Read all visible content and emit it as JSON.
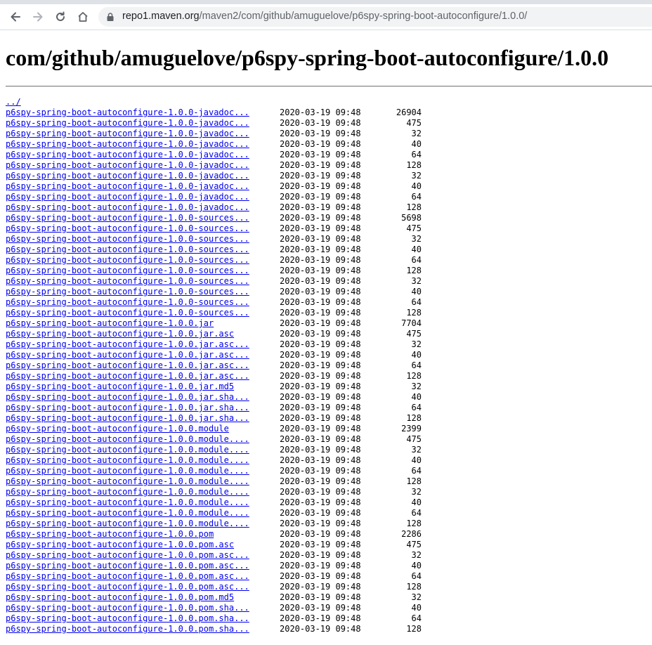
{
  "browser": {
    "url_host": "repo1.maven.org",
    "url_path": "/maven2/com/github/amuguelove/p6spy-spring-boot-autoconfigure/1.0.0/",
    "back_icon": "arrow-left-icon",
    "forward_icon": "arrow-right-icon",
    "reload_icon": "reload-icon",
    "home_icon": "home-icon",
    "lock_icon": "lock-icon"
  },
  "page": {
    "title": "com/github/amuguelove/p6spy-spring-boot-autoconfigure/1.0.0",
    "parent_link": "../"
  },
  "files": [
    {
      "name": "p6spy-spring-boot-autoconfigure-1.0.0-javadoc...",
      "date": "2020-03-19 09:48",
      "size": "26904"
    },
    {
      "name": "p6spy-spring-boot-autoconfigure-1.0.0-javadoc...",
      "date": "2020-03-19 09:48",
      "size": "475"
    },
    {
      "name": "p6spy-spring-boot-autoconfigure-1.0.0-javadoc...",
      "date": "2020-03-19 09:48",
      "size": "32"
    },
    {
      "name": "p6spy-spring-boot-autoconfigure-1.0.0-javadoc...",
      "date": "2020-03-19 09:48",
      "size": "40"
    },
    {
      "name": "p6spy-spring-boot-autoconfigure-1.0.0-javadoc...",
      "date": "2020-03-19 09:48",
      "size": "64"
    },
    {
      "name": "p6spy-spring-boot-autoconfigure-1.0.0-javadoc...",
      "date": "2020-03-19 09:48",
      "size": "128"
    },
    {
      "name": "p6spy-spring-boot-autoconfigure-1.0.0-javadoc...",
      "date": "2020-03-19 09:48",
      "size": "32"
    },
    {
      "name": "p6spy-spring-boot-autoconfigure-1.0.0-javadoc...",
      "date": "2020-03-19 09:48",
      "size": "40"
    },
    {
      "name": "p6spy-spring-boot-autoconfigure-1.0.0-javadoc...",
      "date": "2020-03-19 09:48",
      "size": "64"
    },
    {
      "name": "p6spy-spring-boot-autoconfigure-1.0.0-javadoc...",
      "date": "2020-03-19 09:48",
      "size": "128"
    },
    {
      "name": "p6spy-spring-boot-autoconfigure-1.0.0-sources...",
      "date": "2020-03-19 09:48",
      "size": "5698"
    },
    {
      "name": "p6spy-spring-boot-autoconfigure-1.0.0-sources...",
      "date": "2020-03-19 09:48",
      "size": "475"
    },
    {
      "name": "p6spy-spring-boot-autoconfigure-1.0.0-sources...",
      "date": "2020-03-19 09:48",
      "size": "32"
    },
    {
      "name": "p6spy-spring-boot-autoconfigure-1.0.0-sources...",
      "date": "2020-03-19 09:48",
      "size": "40"
    },
    {
      "name": "p6spy-spring-boot-autoconfigure-1.0.0-sources...",
      "date": "2020-03-19 09:48",
      "size": "64"
    },
    {
      "name": "p6spy-spring-boot-autoconfigure-1.0.0-sources...",
      "date": "2020-03-19 09:48",
      "size": "128"
    },
    {
      "name": "p6spy-spring-boot-autoconfigure-1.0.0-sources...",
      "date": "2020-03-19 09:48",
      "size": "32"
    },
    {
      "name": "p6spy-spring-boot-autoconfigure-1.0.0-sources...",
      "date": "2020-03-19 09:48",
      "size": "40"
    },
    {
      "name": "p6spy-spring-boot-autoconfigure-1.0.0-sources...",
      "date": "2020-03-19 09:48",
      "size": "64"
    },
    {
      "name": "p6spy-spring-boot-autoconfigure-1.0.0-sources...",
      "date": "2020-03-19 09:48",
      "size": "128"
    },
    {
      "name": "p6spy-spring-boot-autoconfigure-1.0.0.jar",
      "date": "2020-03-19 09:48",
      "size": "7704"
    },
    {
      "name": "p6spy-spring-boot-autoconfigure-1.0.0.jar.asc",
      "date": "2020-03-19 09:48",
      "size": "475"
    },
    {
      "name": "p6spy-spring-boot-autoconfigure-1.0.0.jar.asc...",
      "date": "2020-03-19 09:48",
      "size": "32"
    },
    {
      "name": "p6spy-spring-boot-autoconfigure-1.0.0.jar.asc...",
      "date": "2020-03-19 09:48",
      "size": "40"
    },
    {
      "name": "p6spy-spring-boot-autoconfigure-1.0.0.jar.asc...",
      "date": "2020-03-19 09:48",
      "size": "64"
    },
    {
      "name": "p6spy-spring-boot-autoconfigure-1.0.0.jar.asc...",
      "date": "2020-03-19 09:48",
      "size": "128"
    },
    {
      "name": "p6spy-spring-boot-autoconfigure-1.0.0.jar.md5",
      "date": "2020-03-19 09:48",
      "size": "32"
    },
    {
      "name": "p6spy-spring-boot-autoconfigure-1.0.0.jar.sha...",
      "date": "2020-03-19 09:48",
      "size": "40"
    },
    {
      "name": "p6spy-spring-boot-autoconfigure-1.0.0.jar.sha...",
      "date": "2020-03-19 09:48",
      "size": "64"
    },
    {
      "name": "p6spy-spring-boot-autoconfigure-1.0.0.jar.sha...",
      "date": "2020-03-19 09:48",
      "size": "128"
    },
    {
      "name": "p6spy-spring-boot-autoconfigure-1.0.0.module",
      "date": "2020-03-19 09:48",
      "size": "2399"
    },
    {
      "name": "p6spy-spring-boot-autoconfigure-1.0.0.module....",
      "date": "2020-03-19 09:48",
      "size": "475"
    },
    {
      "name": "p6spy-spring-boot-autoconfigure-1.0.0.module....",
      "date": "2020-03-19 09:48",
      "size": "32"
    },
    {
      "name": "p6spy-spring-boot-autoconfigure-1.0.0.module....",
      "date": "2020-03-19 09:48",
      "size": "40"
    },
    {
      "name": "p6spy-spring-boot-autoconfigure-1.0.0.module....",
      "date": "2020-03-19 09:48",
      "size": "64"
    },
    {
      "name": "p6spy-spring-boot-autoconfigure-1.0.0.module....",
      "date": "2020-03-19 09:48",
      "size": "128"
    },
    {
      "name": "p6spy-spring-boot-autoconfigure-1.0.0.module....",
      "date": "2020-03-19 09:48",
      "size": "32"
    },
    {
      "name": "p6spy-spring-boot-autoconfigure-1.0.0.module....",
      "date": "2020-03-19 09:48",
      "size": "40"
    },
    {
      "name": "p6spy-spring-boot-autoconfigure-1.0.0.module....",
      "date": "2020-03-19 09:48",
      "size": "64"
    },
    {
      "name": "p6spy-spring-boot-autoconfigure-1.0.0.module....",
      "date": "2020-03-19 09:48",
      "size": "128"
    },
    {
      "name": "p6spy-spring-boot-autoconfigure-1.0.0.pom",
      "date": "2020-03-19 09:48",
      "size": "2286"
    },
    {
      "name": "p6spy-spring-boot-autoconfigure-1.0.0.pom.asc",
      "date": "2020-03-19 09:48",
      "size": "475"
    },
    {
      "name": "p6spy-spring-boot-autoconfigure-1.0.0.pom.asc...",
      "date": "2020-03-19 09:48",
      "size": "32"
    },
    {
      "name": "p6spy-spring-boot-autoconfigure-1.0.0.pom.asc...",
      "date": "2020-03-19 09:48",
      "size": "40"
    },
    {
      "name": "p6spy-spring-boot-autoconfigure-1.0.0.pom.asc...",
      "date": "2020-03-19 09:48",
      "size": "64"
    },
    {
      "name": "p6spy-spring-boot-autoconfigure-1.0.0.pom.asc...",
      "date": "2020-03-19 09:48",
      "size": "128"
    },
    {
      "name": "p6spy-spring-boot-autoconfigure-1.0.0.pom.md5",
      "date": "2020-03-19 09:48",
      "size": "32"
    },
    {
      "name": "p6spy-spring-boot-autoconfigure-1.0.0.pom.sha...",
      "date": "2020-03-19 09:48",
      "size": "40"
    },
    {
      "name": "p6spy-spring-boot-autoconfigure-1.0.0.pom.sha...",
      "date": "2020-03-19 09:48",
      "size": "64"
    },
    {
      "name": "p6spy-spring-boot-autoconfigure-1.0.0.pom.sha...",
      "date": "2020-03-19 09:48",
      "size": "128"
    }
  ]
}
